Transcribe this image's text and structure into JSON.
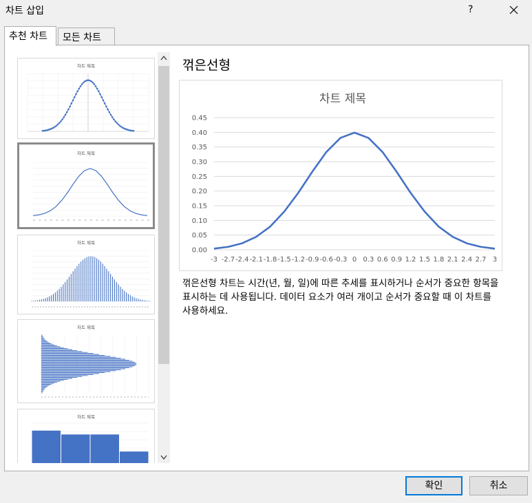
{
  "window": {
    "title": "차트 삽입",
    "help_label": "?"
  },
  "tabs": [
    {
      "label": "추천 차트",
      "active": true
    },
    {
      "label": "모든 차트",
      "active": false
    }
  ],
  "thumbnail_title": "차트 제목",
  "selected_chart": {
    "name": "꺾은선형",
    "description": "꺾은선형 차트는 시간(년, 월, 일)에 따른 추세를 표시하거나 순서가 중요한 항목을 표시하는 데 사용됩니다. 데이터 요소가 여러 개이고 순서가 중요할 때 이 차트를 사용하세요."
  },
  "buttons": {
    "ok": "확인",
    "cancel": "취소"
  },
  "colors": {
    "series": "#4472c4",
    "gridline": "#d9d9d9",
    "axis_text": "#595959",
    "selected_border": "#8a8a8a",
    "ok_border": "#0078d7"
  },
  "icons": {
    "close": "close-icon",
    "scroll_up": "chevron-up-icon",
    "scroll_down": "chevron-down-icon"
  },
  "chart_data": {
    "type": "line",
    "title": "차트 제목",
    "xlabel": "",
    "ylabel": "",
    "x": [
      -3,
      -2.7,
      -2.4,
      -2.1,
      -1.8,
      -1.5,
      -1.2,
      -0.9,
      -0.6,
      -0.3,
      0,
      0.3,
      0.6,
      0.9,
      1.2,
      1.5,
      1.8,
      2.1,
      2.4,
      2.7,
      3
    ],
    "x_tick_labels": [
      "-3",
      "-2.7",
      "-2.4",
      "-2.1",
      "-1.8",
      "-1.5",
      "-1.2",
      "-0.9",
      "-0.6",
      "-0.3",
      "0",
      "0.3",
      "0.6",
      "0.9",
      "1.2",
      "1.5",
      "1.8",
      "2.1",
      "2.4",
      "2.7",
      "3"
    ],
    "series": [
      {
        "values": [
          0.004,
          0.01,
          0.022,
          0.044,
          0.079,
          0.13,
          0.194,
          0.266,
          0.333,
          0.381,
          0.399,
          0.381,
          0.333,
          0.266,
          0.194,
          0.13,
          0.079,
          0.044,
          0.022,
          0.01,
          0.004
        ]
      }
    ],
    "ylim": [
      0,
      0.45
    ],
    "y_ticks": [
      "0.00",
      "0.05",
      "0.10",
      "0.15",
      "0.20",
      "0.25",
      "0.30",
      "0.35",
      "0.40",
      "0.45"
    ],
    "grid": true,
    "legend": "none"
  }
}
